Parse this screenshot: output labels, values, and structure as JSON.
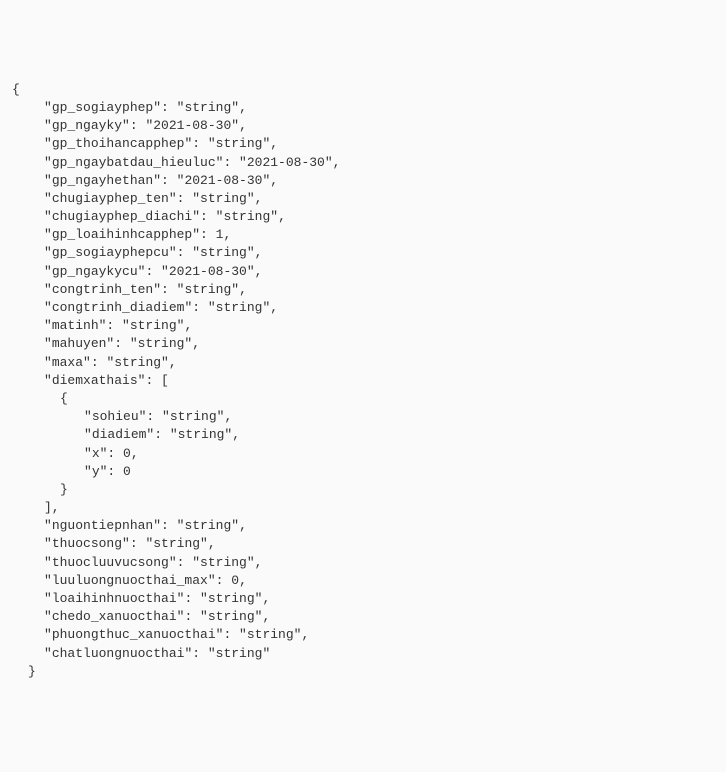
{
  "open_brace": "{",
  "props": [
    {
      "key": "gp_sogiayphep",
      "value": "\"string\"",
      "comma": ","
    },
    {
      "key": "gp_ngayky",
      "value": "\"2021-08-30\"",
      "comma": ","
    },
    {
      "key": "gp_thoihancapphep",
      "value": "\"string\"",
      "comma": ","
    },
    {
      "key": "gp_ngaybatdau_hieuluc",
      "value": "\"2021-08-30\"",
      "comma": ","
    },
    {
      "key": "gp_ngayhethan",
      "value": "\"2021-08-30\"",
      "comma": ","
    },
    {
      "key": "chugiayphep_ten",
      "value": "\"string\"",
      "comma": ","
    },
    {
      "key": "chugiayphep_diachi",
      "value": "\"string\"",
      "comma": ","
    },
    {
      "key": "gp_loaihinhcapphep",
      "value": "1",
      "comma": ","
    },
    {
      "key": "gp_sogiayphepcu",
      "value": "\"string\"",
      "comma": ","
    },
    {
      "key": "gp_ngaykycu",
      "value": "\"2021-08-30\"",
      "comma": ","
    },
    {
      "key": "congtrinh_ten",
      "value": "\"string\"",
      "comma": ","
    },
    {
      "key": "congtrinh_diadiem",
      "value": "\"string\"",
      "comma": ","
    },
    {
      "key": "matinh",
      "value": "\"string\"",
      "comma": ","
    },
    {
      "key": "mahuyen",
      "value": "\"string\"",
      "comma": ","
    },
    {
      "key": "maxa",
      "value": "\"string\"",
      "comma": ","
    }
  ],
  "arr_key": "diemxathais",
  "arr_open": "[",
  "arr_item_open": "{",
  "arr_item_props": [
    {
      "key": "sohieu",
      "value": "\"string\"",
      "comma": ","
    },
    {
      "key": "diadiem",
      "value": "\"string\"",
      "comma": ","
    },
    {
      "key": "x",
      "value": "0",
      "comma": ","
    },
    {
      "key": "y",
      "value": "0",
      "comma": ""
    }
  ],
  "arr_item_close": "}",
  "arr_close": "],",
  "props_after": [
    {
      "key": "nguontiepnhan",
      "value": "\"string\"",
      "comma": ","
    },
    {
      "key": "thuocsong",
      "value": "\"string\"",
      "comma": ","
    },
    {
      "key": "thuocluuvucsong",
      "value": "\"string\"",
      "comma": ","
    },
    {
      "key": "luuluongnuocthai_max",
      "value": "0",
      "comma": ","
    },
    {
      "key": "loaihinhnuocthai",
      "value": "\"string\"",
      "comma": ","
    },
    {
      "key": "chedo_xanuocthai",
      "value": "\"string\"",
      "comma": ","
    },
    {
      "key": "phuongthuc_xanuocthai",
      "value": "\"string\"",
      "comma": ","
    },
    {
      "key": "chatluongnuocthai",
      "value": "\"string\"",
      "comma": ""
    }
  ],
  "close_brace": "}"
}
